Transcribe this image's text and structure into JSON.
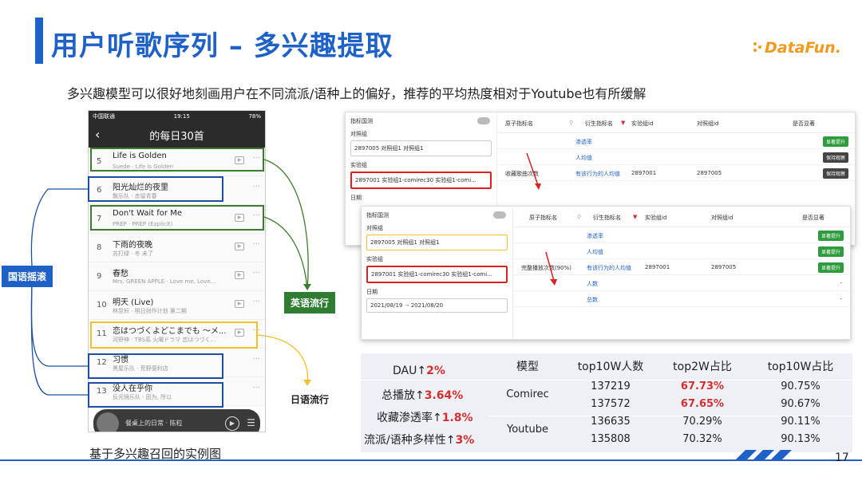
{
  "title": "用户听歌序列 – 多兴趣提取",
  "subtitle": "多兴趣模型可以很好地刻画用户在不同流派/语种上的偏好，推荐的平均热度相对于Youtube也有所缓解",
  "logo": "DataFun.",
  "page_number": "17",
  "caption": "基于多兴趣召回的实例图",
  "tags": {
    "guoyu": "国语摇滚",
    "english": "英语流行",
    "japanese": "日语流行"
  },
  "phone": {
    "status_left": "中国联通",
    "status_time": "19:15",
    "status_right": "78%",
    "header_title": "的每日30首",
    "songs": [
      {
        "num": "5",
        "title": "Life is Golden",
        "sub": "Suede · Life is Golden"
      },
      {
        "num": "6",
        "title": "阳光灿烂的夜里",
        "sub": "飘乐队 · 赤留青春"
      },
      {
        "num": "7",
        "title": "Don't Wait for Me",
        "sub": "PREP · PREP (Explicit)"
      },
      {
        "num": "8",
        "title": "下雨的夜晚",
        "sub": "苏打绿 · 冬 未了"
      },
      {
        "num": "9",
        "title": "春愁",
        "sub": "Mrs. GREEN APPLE · Love me, Love..."
      },
      {
        "num": "10",
        "title": "明天 (Live)",
        "sub": "林昱轩 · 明日创作计划 第二期"
      },
      {
        "num": "11",
        "title": "恋はつづくよどこまでも ～メ...",
        "sub": "河野伸 · TBS系 火曜ドラマ 恋はつづく..."
      },
      {
        "num": "12",
        "title": "习惯",
        "sub": "黑屋乐队 · 荒野便利店"
      },
      {
        "num": "13",
        "title": "没人在乎你",
        "sub": "反光镜乐队 · 因为, 所以"
      }
    ],
    "player_text": "餐桌上的日常 · 陈粒"
  },
  "panel1": {
    "filter_title": "指标国测",
    "control_label": "对照组",
    "control_value": "2897005 对照组1 对照组1",
    "exp_label": "实验组",
    "exp_value": "2897001 实验组1-comirec30 实验组1-comi...",
    "date_label": "日期",
    "head": {
      "atomic": "原子指标名",
      "derived": "衍生指标名",
      "exp_id": "实验组id",
      "ctrl_id": "对照组id",
      "sig": "是否显著"
    },
    "rows": [
      {
        "atomic": "",
        "derived": "渗透率",
        "exp_id": "",
        "ctrl_id": "",
        "btn": "显著提升",
        "btn_type": "g"
      },
      {
        "atomic": "",
        "derived": "人均值",
        "exp_id": "",
        "ctrl_id": "",
        "btn": "保持观察",
        "btn_type": "d"
      },
      {
        "atomic": "收藏歌曲次数",
        "derived": "有该行为的人均值",
        "exp_id": "2897001",
        "ctrl_id": "2897005",
        "btn": "保持观察",
        "btn_type": "d"
      }
    ]
  },
  "panel2": {
    "filter_title": "指标国测",
    "control_label": "对照组",
    "control_value": "2897005 对照组1 对照组1",
    "exp_label": "实验组",
    "exp_value": "2897001 实验组1-comirec30 实验组1-comi...",
    "date_label": "日期",
    "date_from": "2021/08/19",
    "date_to": "2021/08/20",
    "head": {
      "atomic": "原子指标名",
      "derived": "衍生指标名",
      "exp_id": "实验组id",
      "ctrl_id": "对照组id",
      "sig": "是否显著"
    },
    "rows": [
      {
        "atomic": "",
        "derived": "渗透率",
        "exp_id": "",
        "ctrl_id": "",
        "btn": "显著提升"
      },
      {
        "atomic": "",
        "derived": "人均值",
        "exp_id": "",
        "ctrl_id": "",
        "btn": "显著提升"
      },
      {
        "atomic": "完整播放次数(90%)",
        "derived": "有该行为的人均值",
        "exp_id": "2897001",
        "ctrl_id": "2897005",
        "btn": "显著提升"
      },
      {
        "atomic": "",
        "derived": "人数",
        "exp_id": "",
        "ctrl_id": "",
        "btn": "-"
      },
      {
        "atomic": "",
        "derived": "总数",
        "exp_id": "",
        "ctrl_id": "",
        "btn": "-"
      }
    ]
  },
  "metrics": {
    "left": [
      {
        "label": "DAU↑",
        "pct": "2%"
      },
      {
        "label": "总播放↑",
        "pct": "3.64%"
      },
      {
        "label": "收藏渗透率↑",
        "pct": "1.8%"
      },
      {
        "label": "流派/语种多样性↑",
        "pct": "3%"
      }
    ],
    "headers": [
      "模型",
      "top10W人数",
      "top2W占比",
      "top10W占比"
    ],
    "models": [
      "Comirec",
      "Youtube"
    ],
    "rows": [
      [
        "137219",
        "67.73%",
        "90.75%"
      ],
      [
        "137572",
        "67.65%",
        "90.67%"
      ],
      [
        "136635",
        "70.29%",
        "90.11%"
      ],
      [
        "135808",
        "70.32%",
        "90.13%"
      ]
    ],
    "highlight_color": "#d32f2f"
  },
  "colors": {
    "brand": "#1e62c8",
    "green": "#2e7d32",
    "yellow": "#f2c12e",
    "red": "#d32f2f"
  }
}
